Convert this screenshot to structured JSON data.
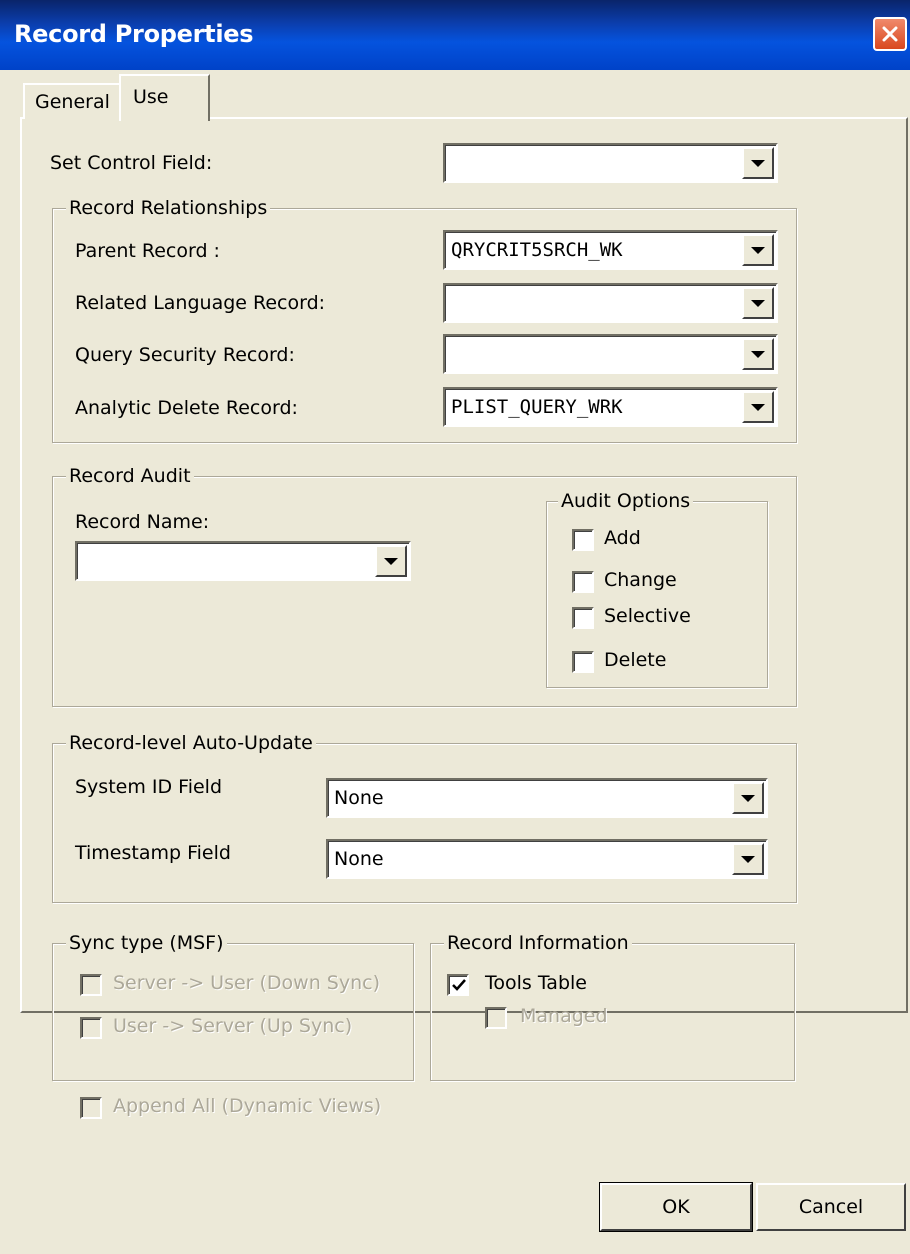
{
  "window": {
    "title": "Record Properties"
  },
  "tabs": [
    {
      "label": "General"
    },
    {
      "label": "Use"
    }
  ],
  "set_control_field": {
    "label": "Set Control Field:",
    "value": ""
  },
  "record_relationships": {
    "legend": "Record Relationships",
    "parent_record": {
      "label": "Parent Record :",
      "value": "QRYCRIT5SRCH_WK"
    },
    "related_language_record": {
      "label": "Related Language Record:",
      "value": ""
    },
    "query_security_record": {
      "label": "Query Security Record:",
      "value": ""
    },
    "analytic_delete_record": {
      "label": "Analytic Delete Record:",
      "value": "PLIST_QUERY_WRK"
    }
  },
  "record_audit": {
    "legend": "Record Audit",
    "record_name": {
      "label": "Record Name:",
      "value": ""
    },
    "audit_options": {
      "legend": "Audit Options",
      "items": [
        {
          "label": "Add",
          "checked": false
        },
        {
          "label": "Change",
          "checked": false
        },
        {
          "label": "Selective",
          "checked": false
        },
        {
          "label": "Delete",
          "checked": false
        }
      ]
    }
  },
  "auto_update": {
    "legend": "Record-level Auto-Update",
    "system_id_field": {
      "label": "System ID Field",
      "value": "None"
    },
    "timestamp_field": {
      "label": "Timestamp Field",
      "value": "None"
    }
  },
  "sync_type": {
    "legend": "Sync type (MSF)",
    "down_sync": {
      "label": "Server -> User (Down Sync)",
      "checked": false,
      "enabled": false
    },
    "up_sync": {
      "label": "User -> Server (Up Sync)",
      "checked": false,
      "enabled": false
    }
  },
  "record_information": {
    "legend": "Record Information",
    "tools_table": {
      "label": "Tools Table",
      "checked": true
    },
    "managed": {
      "label": "Managed",
      "checked": false,
      "enabled": false
    }
  },
  "append_all": {
    "label": "Append All (Dynamic Views)",
    "checked": false,
    "enabled": false
  },
  "buttons": {
    "ok": "OK",
    "cancel": "Cancel"
  },
  "colors": {
    "titlebar": "#0553de",
    "dialog_bg": "#ece9d8",
    "close_button": "#d9481f",
    "disabled_text": "#aca899"
  }
}
